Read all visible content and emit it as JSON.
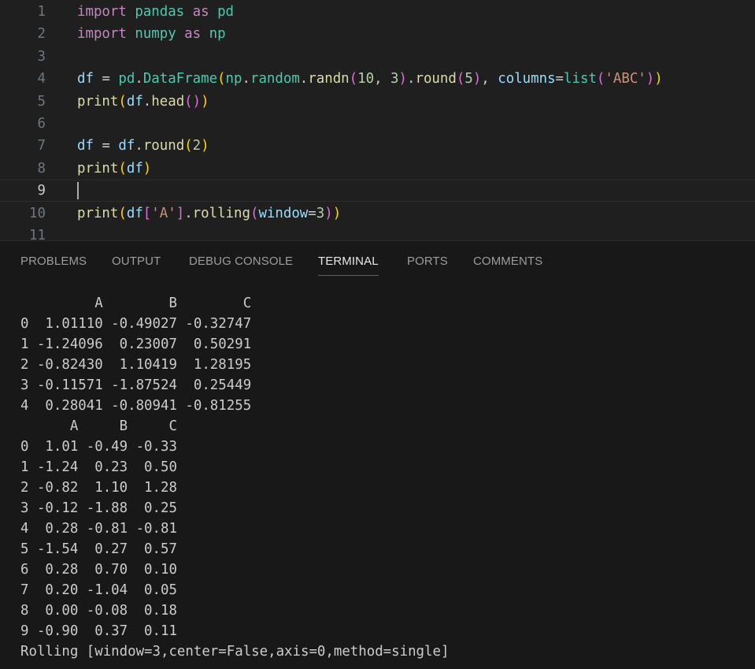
{
  "editor": {
    "lines": [
      {
        "n": "1",
        "tokens": [
          {
            "t": "import",
            "c": "kw"
          },
          {
            "t": " ",
            "c": "pl"
          },
          {
            "t": "pandas",
            "c": "mod"
          },
          {
            "t": " ",
            "c": "pl"
          },
          {
            "t": "as",
            "c": "kw"
          },
          {
            "t": " ",
            "c": "pl"
          },
          {
            "t": "pd",
            "c": "mod"
          }
        ]
      },
      {
        "n": "2",
        "tokens": [
          {
            "t": "import",
            "c": "kw"
          },
          {
            "t": " ",
            "c": "pl"
          },
          {
            "t": "numpy",
            "c": "mod"
          },
          {
            "t": " ",
            "c": "pl"
          },
          {
            "t": "as",
            "c": "kw"
          },
          {
            "t": " ",
            "c": "pl"
          },
          {
            "t": "np",
            "c": "mod"
          }
        ]
      },
      {
        "n": "3",
        "tokens": []
      },
      {
        "n": "4",
        "tokens": [
          {
            "t": "df",
            "c": "vr"
          },
          {
            "t": " = ",
            "c": "op"
          },
          {
            "t": "pd",
            "c": "mod"
          },
          {
            "t": ".",
            "c": "op"
          },
          {
            "t": "DataFrame",
            "c": "mod"
          },
          {
            "t": "(",
            "c": "b1"
          },
          {
            "t": "np",
            "c": "mod"
          },
          {
            "t": ".",
            "c": "op"
          },
          {
            "t": "random",
            "c": "mod"
          },
          {
            "t": ".",
            "c": "op"
          },
          {
            "t": "randn",
            "c": "fn"
          },
          {
            "t": "(",
            "c": "b2"
          },
          {
            "t": "10",
            "c": "num"
          },
          {
            "t": ", ",
            "c": "op"
          },
          {
            "t": "3",
            "c": "num"
          },
          {
            "t": ")",
            "c": "b2"
          },
          {
            "t": ".",
            "c": "op"
          },
          {
            "t": "round",
            "c": "fn"
          },
          {
            "t": "(",
            "c": "b2"
          },
          {
            "t": "5",
            "c": "num"
          },
          {
            "t": ")",
            "c": "b2"
          },
          {
            "t": ", ",
            "c": "op"
          },
          {
            "t": "columns",
            "c": "vr"
          },
          {
            "t": "=",
            "c": "op"
          },
          {
            "t": "list",
            "c": "mod"
          },
          {
            "t": "(",
            "c": "b2"
          },
          {
            "t": "'ABC'",
            "c": "str"
          },
          {
            "t": ")",
            "c": "b2"
          },
          {
            "t": ")",
            "c": "b1"
          }
        ]
      },
      {
        "n": "5",
        "tokens": [
          {
            "t": "print",
            "c": "fn"
          },
          {
            "t": "(",
            "c": "b1"
          },
          {
            "t": "df",
            "c": "vr"
          },
          {
            "t": ".",
            "c": "op"
          },
          {
            "t": "head",
            "c": "fn"
          },
          {
            "t": "()",
            "c": "b2"
          },
          {
            "t": ")",
            "c": "b1"
          }
        ]
      },
      {
        "n": "6",
        "tokens": []
      },
      {
        "n": "7",
        "tokens": [
          {
            "t": "df",
            "c": "vr"
          },
          {
            "t": " = ",
            "c": "op"
          },
          {
            "t": "df",
            "c": "vr"
          },
          {
            "t": ".",
            "c": "op"
          },
          {
            "t": "round",
            "c": "fn"
          },
          {
            "t": "(",
            "c": "b1"
          },
          {
            "t": "2",
            "c": "num"
          },
          {
            "t": ")",
            "c": "b1"
          }
        ]
      },
      {
        "n": "8",
        "tokens": [
          {
            "t": "print",
            "c": "fn"
          },
          {
            "t": "(",
            "c": "b1"
          },
          {
            "t": "df",
            "c": "vr"
          },
          {
            "t": ")",
            "c": "b1"
          }
        ]
      },
      {
        "n": "9",
        "tokens": [],
        "current": true
      },
      {
        "n": "10",
        "tokens": [
          {
            "t": "print",
            "c": "fn"
          },
          {
            "t": "(",
            "c": "b1"
          },
          {
            "t": "df",
            "c": "vr"
          },
          {
            "t": "[",
            "c": "b2"
          },
          {
            "t": "'A'",
            "c": "str"
          },
          {
            "t": "]",
            "c": "b2"
          },
          {
            "t": ".",
            "c": "op"
          },
          {
            "t": "rolling",
            "c": "fn"
          },
          {
            "t": "(",
            "c": "b2"
          },
          {
            "t": "window",
            "c": "vr"
          },
          {
            "t": "=",
            "c": "op"
          },
          {
            "t": "3",
            "c": "num"
          },
          {
            "t": ")",
            "c": "b2"
          },
          {
            "t": ")",
            "c": "b1"
          }
        ]
      },
      {
        "n": "11",
        "tokens": []
      }
    ]
  },
  "panel": {
    "tabs": [
      {
        "id": "problems",
        "label": "PROBLEMS"
      },
      {
        "id": "output",
        "label": "OUTPUT"
      },
      {
        "id": "debug-console",
        "label": "DEBUG CONSOLE"
      },
      {
        "id": "terminal",
        "label": "TERMINAL",
        "active": true
      },
      {
        "id": "ports",
        "label": "PORTS"
      },
      {
        "id": "comments",
        "label": "COMMENTS"
      }
    ],
    "terminal_lines": [
      "         A        B        C",
      "0  1.01110 -0.49027 -0.32747",
      "1 -1.24096  0.23007  0.50291",
      "2 -0.82430  1.10419  1.28195",
      "3 -0.11571 -1.87524  0.25449",
      "4  0.28041 -0.80941 -0.81255",
      "      A     B     C",
      "0  1.01 -0.49 -0.33",
      "1 -1.24  0.23  0.50",
      "2 -0.82  1.10  1.28",
      "3 -0.12 -1.88  0.25",
      "4  0.28 -0.81 -0.81",
      "5 -1.54  0.27  0.57",
      "6  0.28  0.70  0.10",
      "7  0.20 -1.04  0.05",
      "8  0.00 -0.08  0.18",
      "9 -0.90  0.37  0.11",
      "Rolling [window=3,center=False,axis=0,method=single]"
    ]
  }
}
